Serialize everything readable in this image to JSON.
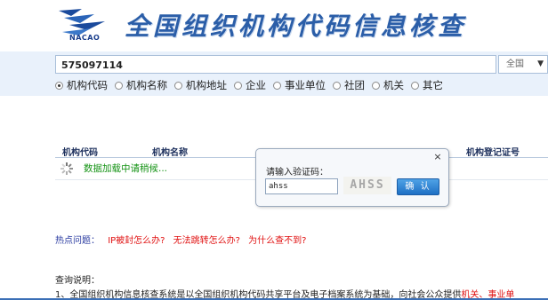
{
  "header": {
    "logo_text": "NACAO",
    "title": "全国组织机构代码信息核查"
  },
  "search": {
    "value": "575097114",
    "scope_selected": "全国"
  },
  "radio_options": [
    {
      "label": "机构代码",
      "checked": true
    },
    {
      "label": "机构名称",
      "checked": false
    },
    {
      "label": "机构地址",
      "checked": false
    },
    {
      "label": "企业",
      "checked": false
    },
    {
      "label": "事业单位",
      "checked": false
    },
    {
      "label": "社团",
      "checked": false
    },
    {
      "label": "机关",
      "checked": false
    },
    {
      "label": "其它",
      "checked": false
    }
  ],
  "results": {
    "columns": [
      "机构代码",
      "机构名称",
      "机构登记证号"
    ],
    "loading_text": "数据加载中请稍候..."
  },
  "dialog": {
    "close": "×",
    "label": "请输入验证码：",
    "input_value": "ahss",
    "captcha_text": "AHSS",
    "confirm_label": "确 认"
  },
  "hot": {
    "label": "热点问题：",
    "links": [
      "IP被封怎么办?",
      "无法跳转怎么办?",
      "为什么查不到?"
    ]
  },
  "instructions": {
    "title": "查询说明：",
    "line1_prefix": "1、全国组织机构信息核查系统是以全国组织机构代码共享平台及电子档案系统为基础，向社会公众提供",
    "line1_red": "机关、事业单"
  },
  "colors": {
    "title_blue": "#2b5ea8",
    "band": "#e9f1fb",
    "loading_green": "#159315",
    "link_red": "#e01010",
    "button_blue": "#1e6fc4"
  }
}
